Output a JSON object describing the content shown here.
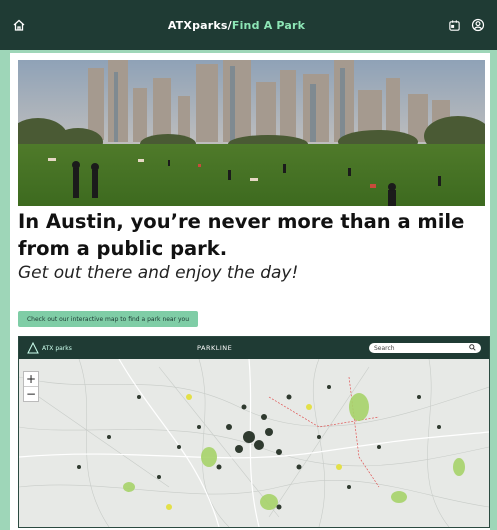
{
  "header": {
    "brand": "ATXparks",
    "separator": "/",
    "section": "Find A Park"
  },
  "hero": {
    "headline": "In Austin, you’re never more than a mile from a public park.",
    "subheadline": "Get out there and enjoy the day!"
  },
  "cta": {
    "label": "Check out our interactive map to find a park near you"
  },
  "map": {
    "logo_text": "ATX parks",
    "title": "PARKLINE",
    "search_placeholder": "Search",
    "zoom_in": "+",
    "zoom_out": "−"
  },
  "colors": {
    "header_bg": "#1f3b34",
    "accent": "#8de6b6",
    "page_bg": "#9ed6b8",
    "cta_bg": "#7fcda6"
  },
  "icons": [
    "home-icon",
    "calendar-icon",
    "account-icon",
    "search-icon"
  ]
}
